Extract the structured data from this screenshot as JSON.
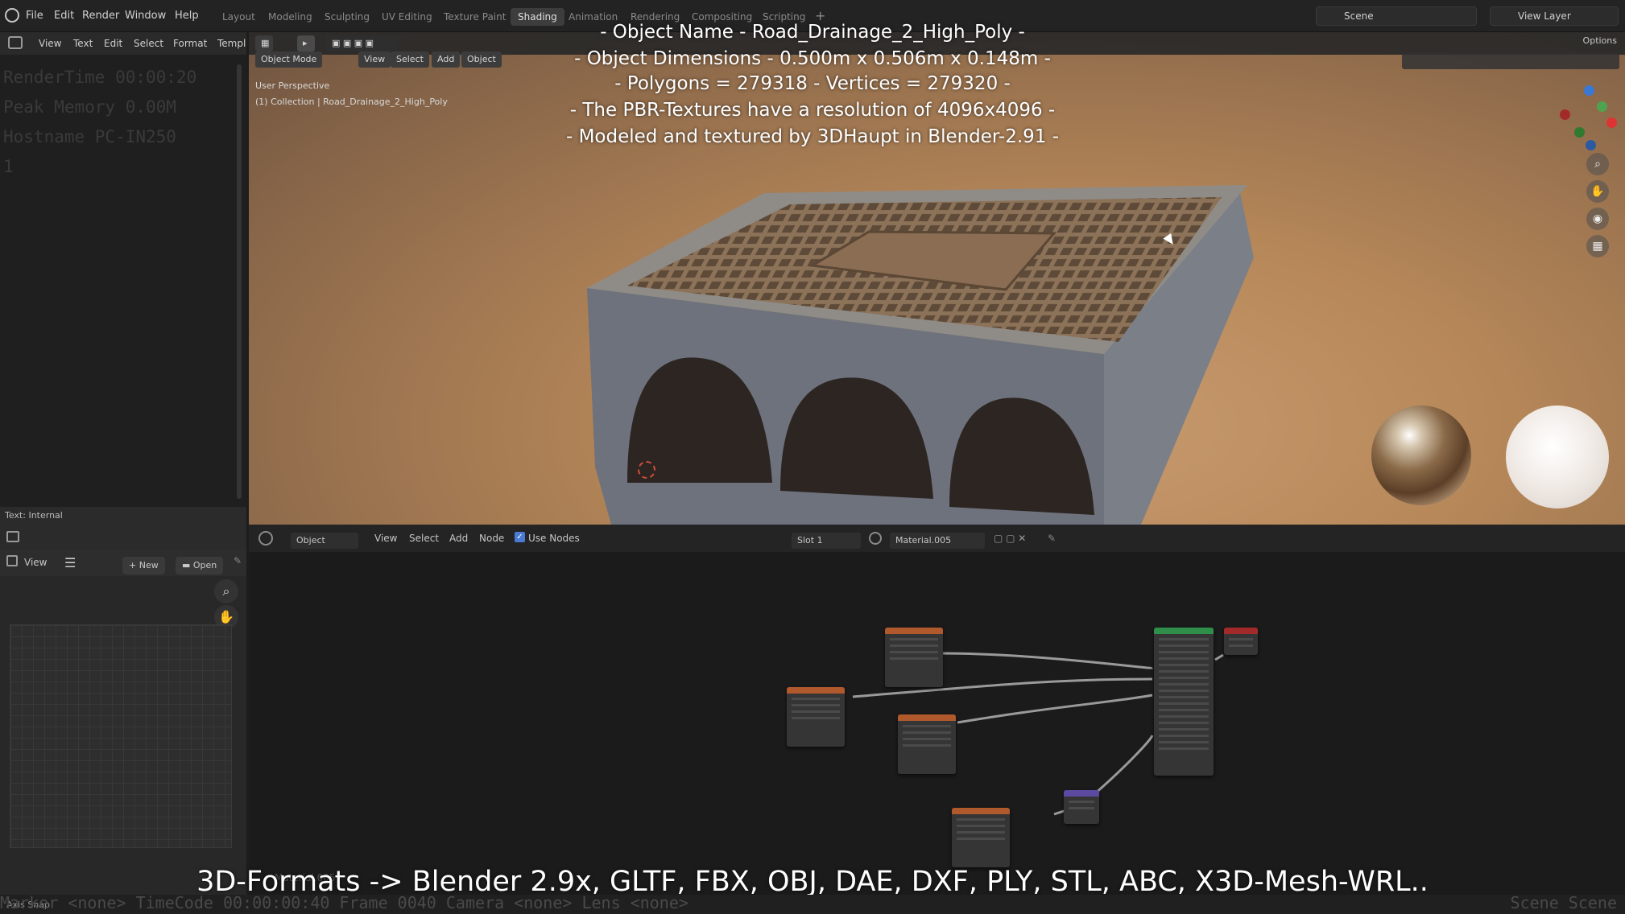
{
  "menubar": {
    "items": [
      "File",
      "Edit",
      "Render",
      "Window",
      "Help"
    ],
    "workspaces": [
      "Layout",
      "Modeling",
      "Sculpting",
      "UV Editing",
      "Texture Paint",
      "Shading",
      "Animation",
      "Rendering",
      "Compositing",
      "Scripting"
    ],
    "active_workspace": "Shading",
    "scene_label": "Scene",
    "view_layer_label": "View Layer"
  },
  "text_editor": {
    "menu": [
      "View",
      "Text",
      "Edit",
      "Select",
      "Format",
      "Templ"
    ],
    "lines": [
      "RenderTime 00:00:20",
      "Peak Memory 0.00M",
      "Hostname PC-IN250",
      "1"
    ],
    "footer": "Text: Internal"
  },
  "image_editor": {
    "view_label": "View",
    "new_label": "New",
    "open_label": "Open"
  },
  "viewport": {
    "mode_label": "Object Mode",
    "menu": [
      "View",
      "Select",
      "Add",
      "Object"
    ],
    "info_line1": "User Perspective",
    "info_line2": "(1) Collection | Road_Drainage_2_High_Poly",
    "options_label": "Options"
  },
  "node_editor": {
    "object_label": "Object",
    "menu": [
      "View",
      "Select",
      "Add",
      "Node"
    ],
    "use_nodes_label": "Use Nodes",
    "slot_label": "Slot 1",
    "material_label": "Material.005",
    "material_footer": "Material.005"
  },
  "overlay": {
    "lines": [
      "- Object Name - Road_Drainage_2_High_Poly  -",
      "- Object Dimensions -  0.500m x 0.506m x 0.148m -",
      "- Polygons = 279318  -  Vertices = 279320 -",
      "- The PBR-Textures have a resolution of 4096x4096 -",
      "- Modeled and textured by 3DHaupt in Blender-2.91 -"
    ],
    "formats": "3D-Formats -> Blender 2.9x, GLTF, FBX, OBJ, DAE, DXF, PLY, STL, ABC, X3D-Mesh-WRL.."
  },
  "statusbar": {
    "text": "Marker <none>   TimeCode 00:00:00:40   Frame 0040   Camera <none>   Lens <none>",
    "right_text": "Scene Scene",
    "axis_snap": "Axis Snap"
  },
  "colors": {
    "node_orange": "#b0592d",
    "node_green": "#2f8f4a",
    "node_red": "#a32a2a",
    "node_purple": "#5b4aa0",
    "background_warm": "#b78859"
  }
}
